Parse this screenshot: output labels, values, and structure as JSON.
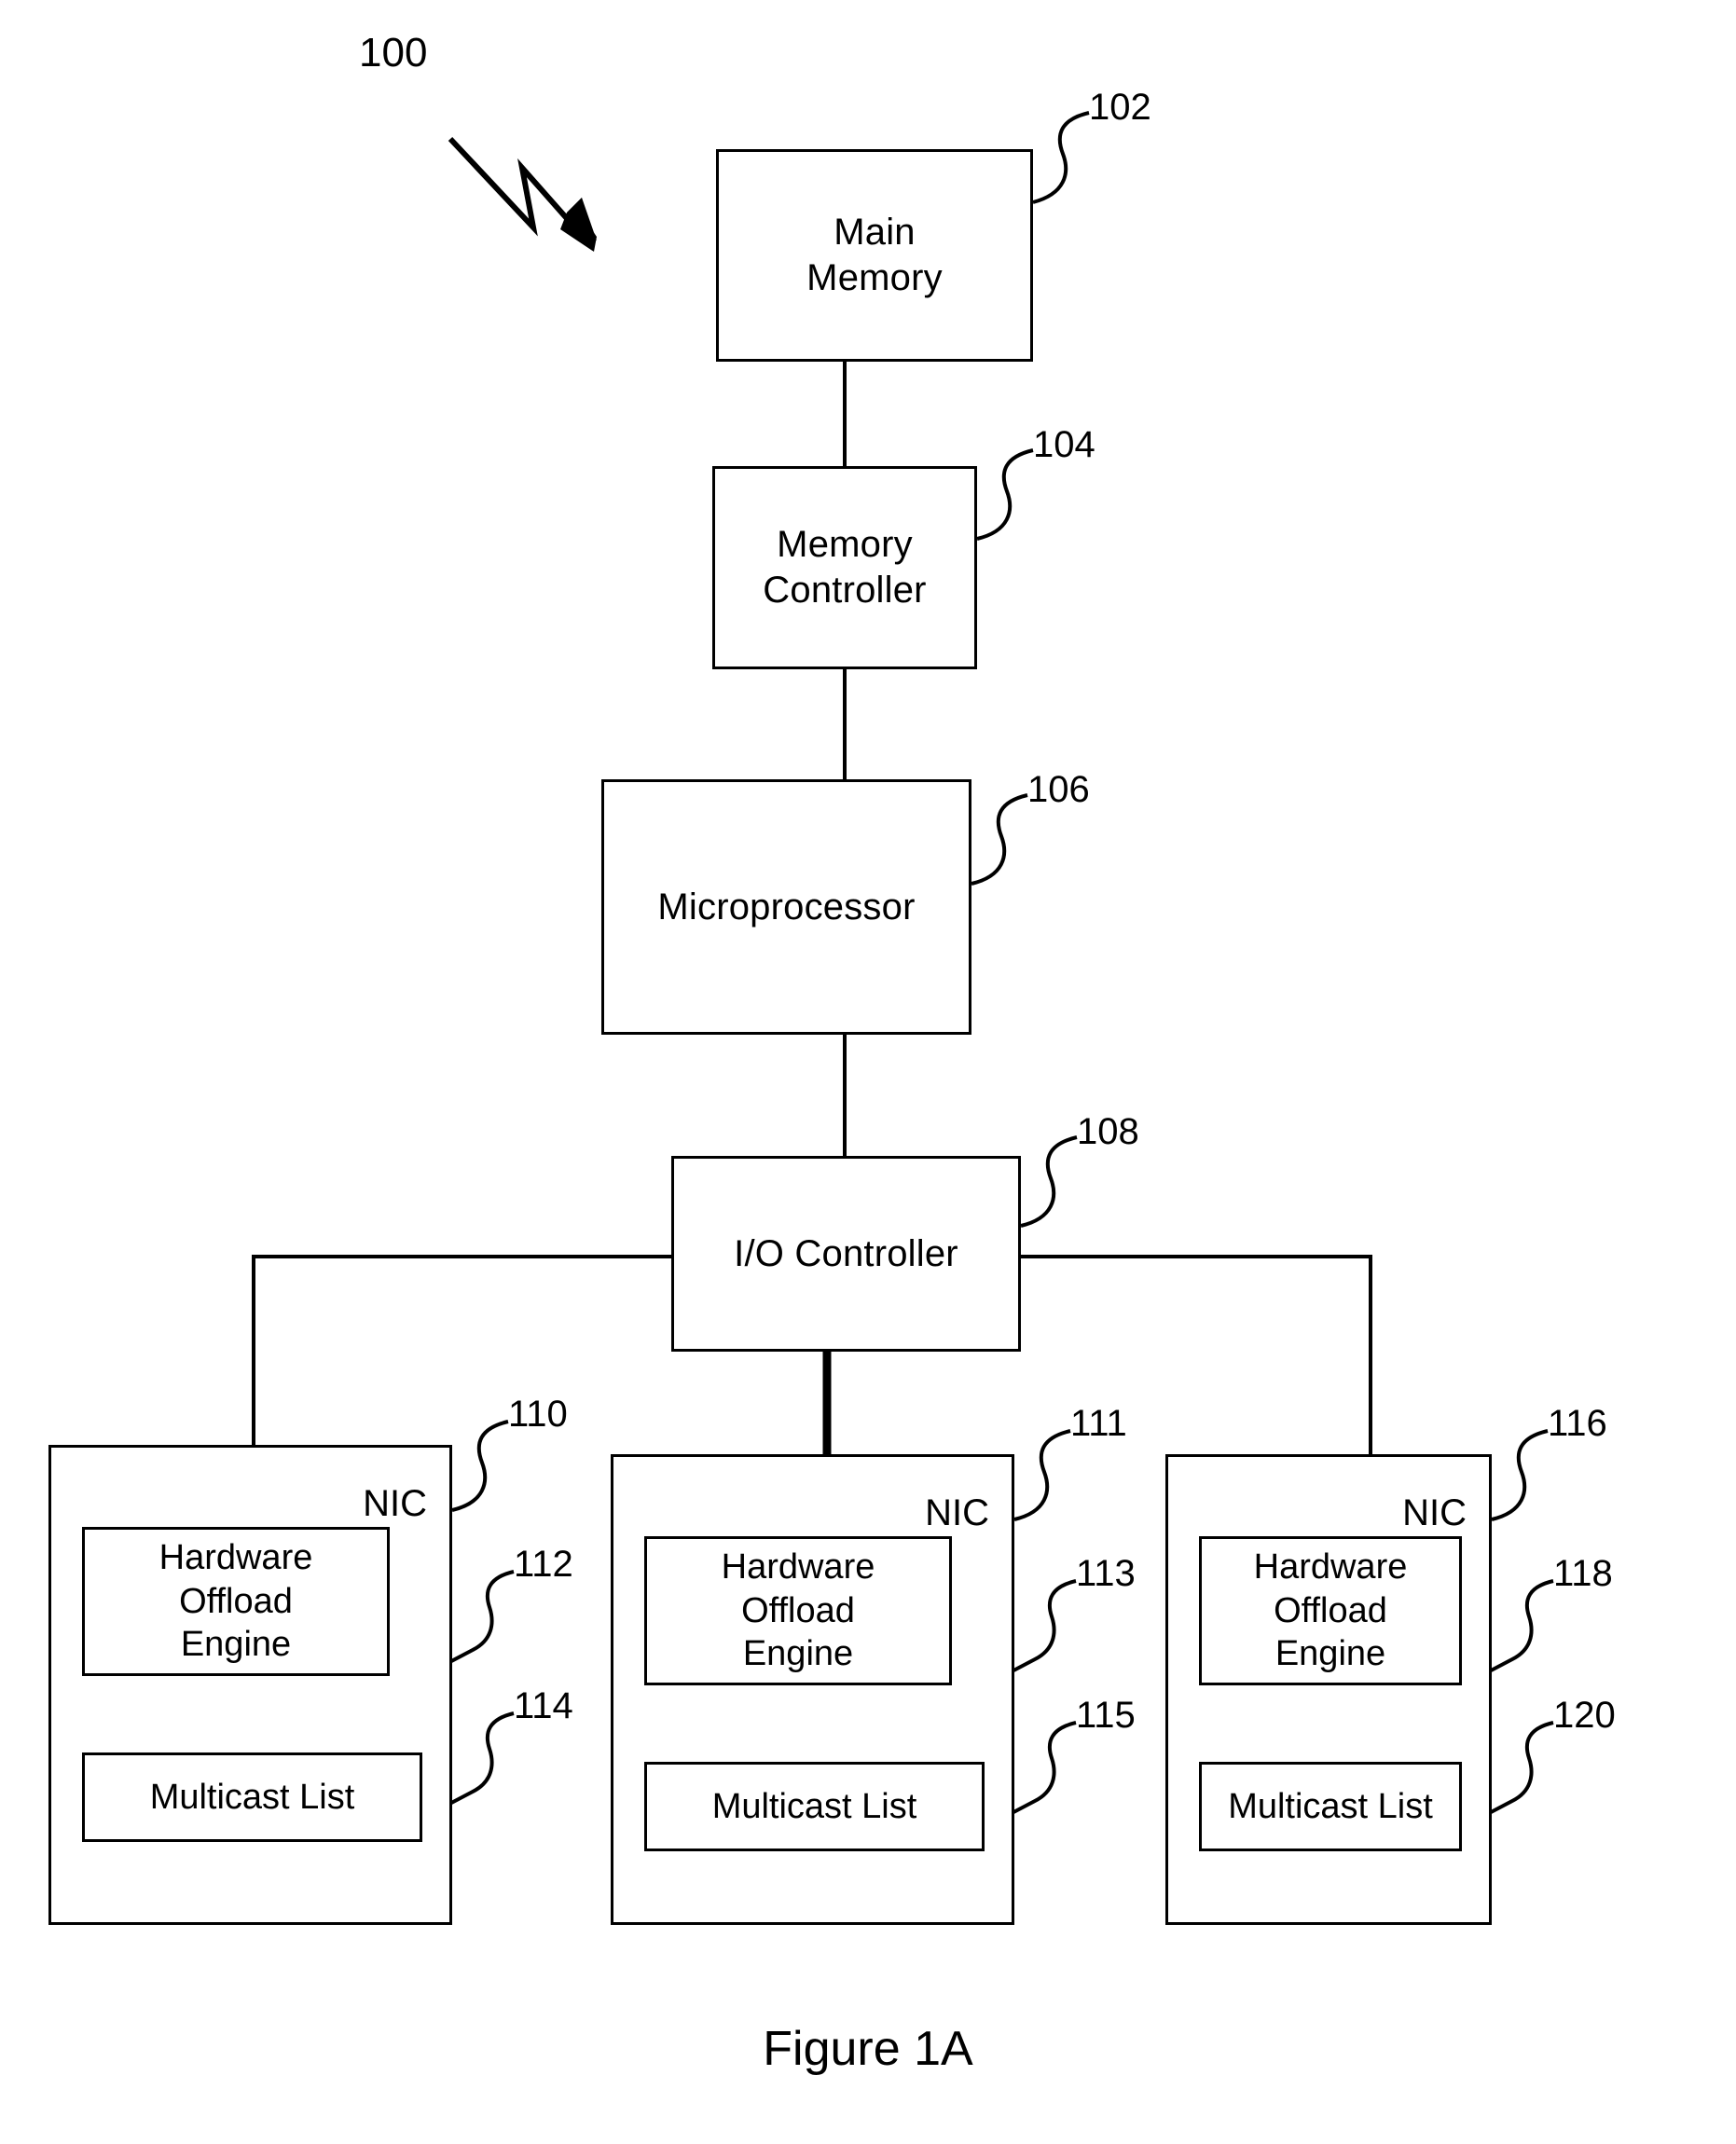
{
  "figure": {
    "caption": "Figure 1A",
    "system_ref": "100"
  },
  "nodes": {
    "main_memory": {
      "label": "Main\nMemory",
      "ref": "102"
    },
    "memory_controller": {
      "label": "Memory\nController",
      "ref": "104"
    },
    "microprocessor": {
      "label": "Microprocessor",
      "ref": "106"
    },
    "io_controller": {
      "label": "I/O Controller",
      "ref": "108"
    }
  },
  "nics": [
    {
      "title": "NIC",
      "ref": "110",
      "offload_engine": {
        "label": "Hardware\nOffload\nEngine",
        "ref": "112"
      },
      "multicast_list": {
        "label": "Multicast List",
        "ref": "114"
      }
    },
    {
      "title": "NIC",
      "ref": "111",
      "offload_engine": {
        "label": "Hardware\nOffload\nEngine",
        "ref": "113"
      },
      "multicast_list": {
        "label": "Multicast List",
        "ref": "115"
      }
    },
    {
      "title": "NIC",
      "ref": "116",
      "offload_engine": {
        "label": "Hardware\nOffload\nEngine",
        "ref": "118"
      },
      "multicast_list": {
        "label": "Multicast List",
        "ref": "120"
      }
    }
  ],
  "colors": {
    "line": "#000000",
    "background": "#ffffff",
    "text": "#000000"
  }
}
